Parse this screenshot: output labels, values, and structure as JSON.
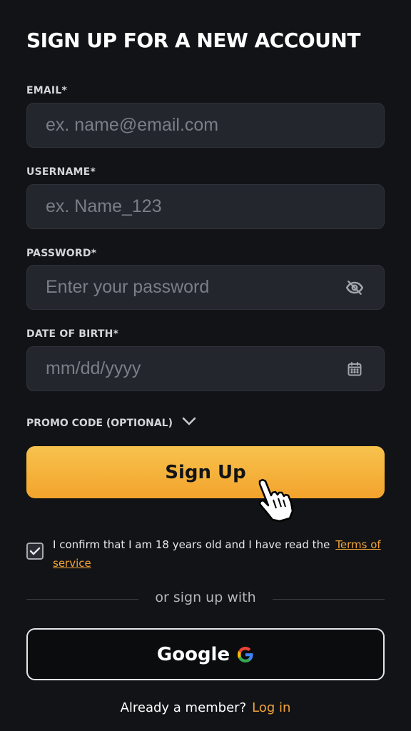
{
  "page": {
    "title": "SIGN UP FOR A NEW ACCOUNT"
  },
  "form": {
    "email": {
      "label": "EMAIL*",
      "placeholder": "ex. name@email.com",
      "value": ""
    },
    "username": {
      "label": "USERNAME*",
      "placeholder": "ex. Name_123",
      "value": ""
    },
    "password": {
      "label": "PASSWORD*",
      "placeholder": "Enter your password",
      "value": "",
      "icon": "eye-off-icon"
    },
    "dob": {
      "label": "DATE OF BIRTH*",
      "placeholder": "mm/dd/yyyy",
      "value": "",
      "icon": "calendar-icon"
    },
    "promo": {
      "label": "PROMO CODE (OPTIONAL)",
      "icon": "chevron-down-icon"
    }
  },
  "actions": {
    "signup_label": "Sign Up",
    "google_label": "Google"
  },
  "confirm": {
    "checked": true,
    "text": "I confirm that I am 18 years old and I have read the",
    "link_label": "Terms of service"
  },
  "divider": {
    "text": "or sign up with"
  },
  "footer": {
    "text": "Already a member?",
    "link_label": "Log in"
  },
  "colors": {
    "background": "#121316",
    "field_bg": "#23262d",
    "accent": "#f2a33a",
    "button_gradient_top": "#f7c34d",
    "button_gradient_bottom": "#f3a32c"
  }
}
